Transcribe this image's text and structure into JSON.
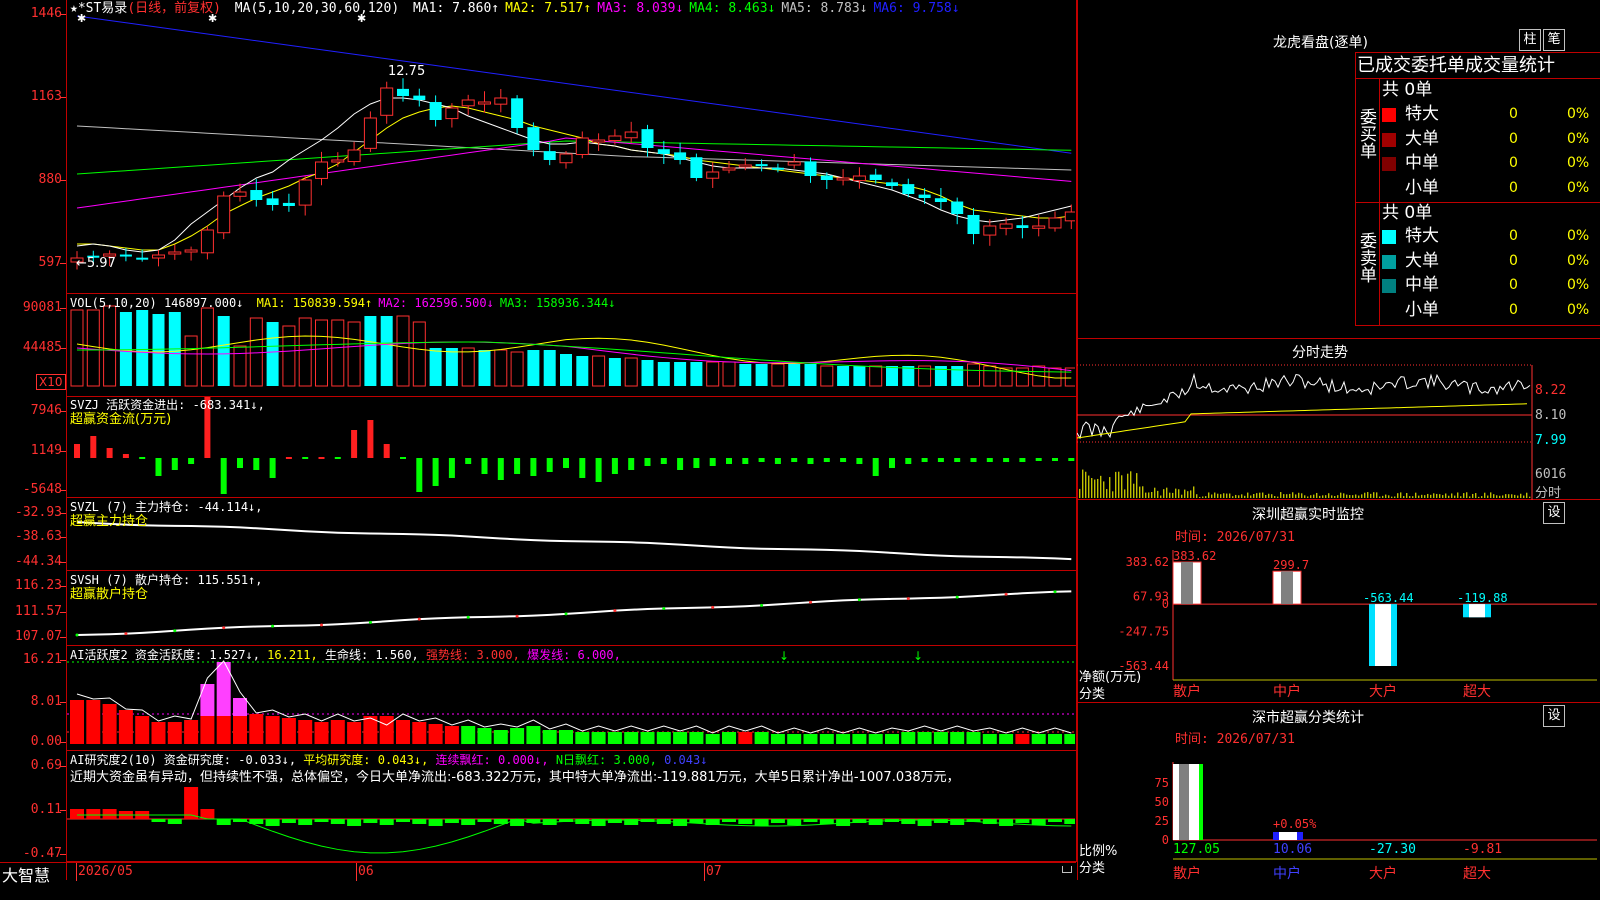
{
  "main_chart": {
    "title_stock": "★*ST易录",
    "title_mode": "(日线，前复权)",
    "ma_label": "MA(5,10,20,30,60,120)",
    "ma": [
      {
        "label": "MA1: 7.860↑",
        "color": "#ffffff"
      },
      {
        "label": "MA2: 7.517↑",
        "color": "#ffff00"
      },
      {
        "label": "MA3: 8.039↓",
        "color": "#ff00ff"
      },
      {
        "label": "MA4: 8.463↓",
        "color": "#00ff00"
      },
      {
        "label": "MA5: 8.783↓",
        "color": "#c0c0c0"
      },
      {
        "label": "MA6: 9.758↓",
        "color": "#2020ff"
      }
    ],
    "y_ticks": [
      "1446",
      "1163",
      "880",
      "597"
    ],
    "high_label": "12.75",
    "low_label": "5.97"
  },
  "vol_panel": {
    "label": "VOL(5,10,20)",
    "value": "146897.000↓",
    "ma": [
      {
        "label": "MA1: 150839.594↑",
        "color": "#ffff00"
      },
      {
        "label": "MA2: 162596.500↓",
        "color": "#ff00ff"
      },
      {
        "label": "MA3: 158936.344↓",
        "color": "#00ff00"
      }
    ],
    "y_ticks": [
      "90081",
      "44485"
    ],
    "unit": "X10"
  },
  "svzj_panel": {
    "label": "SVZJ  活跃资金进出: -683.341↓,",
    "sub": "超赢资金流(万元)",
    "y_ticks": [
      "7946",
      "1149",
      "-5648"
    ]
  },
  "svzl_panel": {
    "label": "SVZL (7) 主力持仓: -44.114↓,",
    "sub": "超赢主力持仓",
    "y_ticks": [
      "-32.93",
      "-38.63",
      "-44.34"
    ]
  },
  "svsh_panel": {
    "label": "SVSH (7) 散户持仓: 115.551↑,",
    "sub": "超赢散户持仓",
    "y_ticks": [
      "116.23",
      "111.57",
      "107.07"
    ]
  },
  "ai_active": {
    "label": "AI活跃度2 资金活跃度: 1.527↓,",
    "v2": "16.211,",
    "v3": "生命线: 1.560,",
    "v4": "强势线: 3.000,",
    "v5": "爆发线: 6.000,",
    "y_ticks": [
      "16.21",
      "8.01",
      "0.00"
    ]
  },
  "ai_research": {
    "label": "AI研究度2(10) 资金研究度: -0.033↓,",
    "v2": "平均研究度: 0.043↓,",
    "v3": "连续飘红: 0.000↓,",
    "v4": "N日飘红: 3.000,",
    "v5": "0.043↓",
    "comment": "近期大资金虽有异动，但持续性不强，总体偏空，今日大单净流出:-683.322万元，其中特大单净流出:-119.881万元，大单5日累计净出-1007.038万元，",
    "y_ticks": [
      "0.69",
      "0.11",
      "-0.47"
    ]
  },
  "bottom_bar": {
    "brand": "大智慧",
    "dates": [
      "2026/05",
      "06",
      "07"
    ]
  },
  "right_panel": {
    "lhb_title": "龙虎看盘(逐单)",
    "btn_zhu": "柱",
    "btn_bi": "笔",
    "stat_title": "已成交委托单成交量统计",
    "buy": {
      "side_label": "委买单",
      "total": "共 0单",
      "rows": [
        {
          "name": "特大",
          "num": "0",
          "pct": "0%",
          "color": "#ff0000"
        },
        {
          "name": "大单",
          "num": "0",
          "pct": "0%",
          "color": "#a00000"
        },
        {
          "name": "中单",
          "num": "0",
          "pct": "0%",
          "color": "#800000"
        },
        {
          "name": "小单",
          "num": "0",
          "pct": "0%",
          "color": ""
        }
      ]
    },
    "sell": {
      "side_label": "委卖单",
      "total": "共 0单",
      "rows": [
        {
          "name": "特大",
          "num": "0",
          "pct": "0%",
          "color": "#00ffff"
        },
        {
          "name": "大单",
          "num": "0",
          "pct": "0%",
          "color": "#00a0a0"
        },
        {
          "name": "中单",
          "num": "0",
          "pct": "0%",
          "color": "#008080"
        },
        {
          "name": "小单",
          "num": "0",
          "pct": "0%",
          "color": ""
        }
      ]
    },
    "intraday_title": "分时走势",
    "intraday_ticks": [
      "8.22",
      "8.10",
      "7.99"
    ],
    "intraday_vol": "6016",
    "intraday_unit": "分时",
    "monitor": {
      "title": "深圳超赢实时监控",
      "btn": "设",
      "time": "时间: 2026/07/31",
      "y_ticks": [
        "383.62",
        "67.93",
        "0",
        "-247.75",
        "-563.44"
      ],
      "ylabel1": "净额(万元)",
      "ylabel2": "分类",
      "categories": [
        "散户",
        "中户",
        "大户",
        "超大"
      ],
      "values": [
        383.62,
        299.7,
        -563.44,
        -119.88
      ],
      "value_labels": [
        "383.62",
        "299.7",
        "-563.44",
        "-119.88"
      ]
    },
    "classify": {
      "title": "深市超赢分类统计",
      "btn": "设",
      "time": "时间: 2026/07/31",
      "y_ticks": [
        "75",
        "50",
        "25",
        "0"
      ],
      "ylabel1": "比例%",
      "ylabel2": "分类",
      "categories": [
        "散户",
        "中户",
        "大户",
        "超大"
      ],
      "values": [
        127.05,
        10.06,
        -27.3,
        -9.81
      ],
      "value_labels": [
        "127.05",
        "10.06",
        "-27.30",
        "-9.81"
      ],
      "mid_label": "+0.05%"
    }
  }
}
